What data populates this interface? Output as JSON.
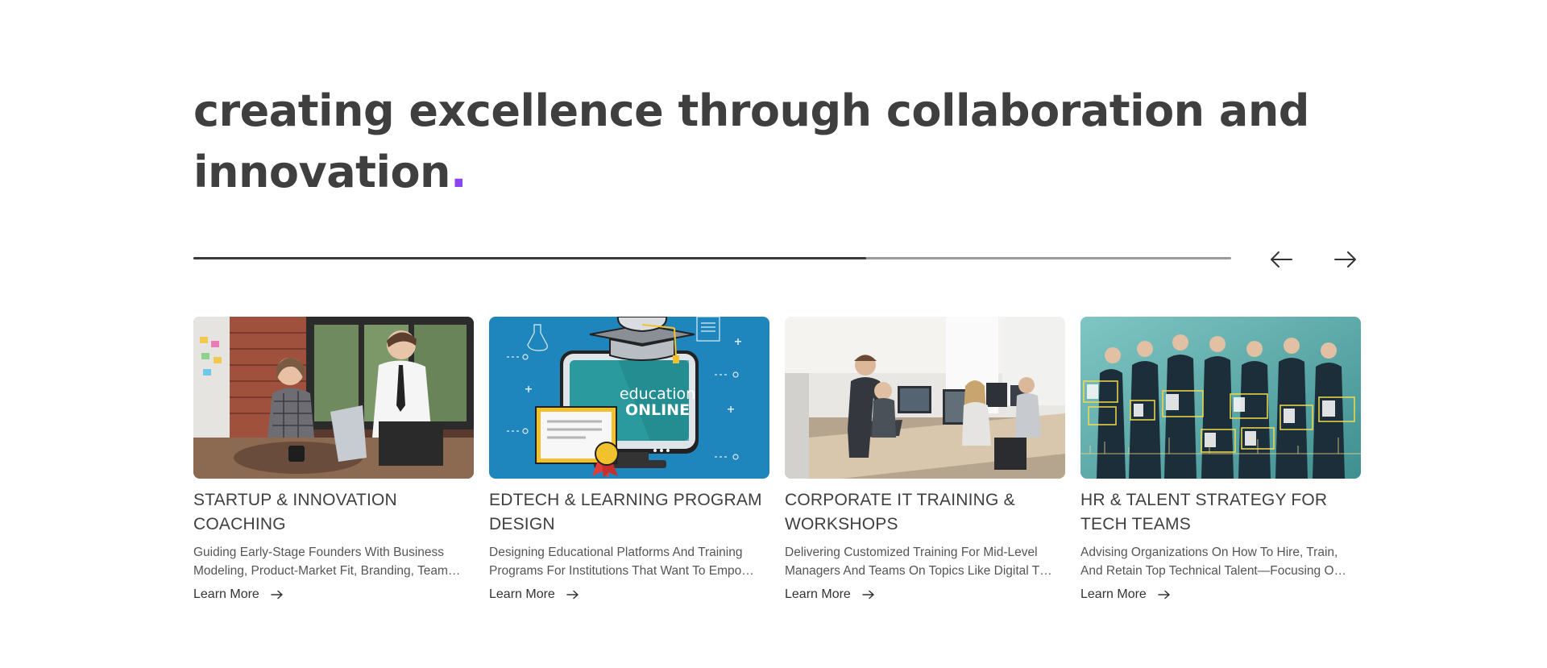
{
  "headline": {
    "line1": "creating excellence through collaboration and",
    "line2": "innovation",
    "accent_dot": ".",
    "accent_color": "#8b45f0"
  },
  "slider": {
    "progress": 0.648,
    "prev_icon": "arrow-left-icon",
    "next_icon": "arrow-right-icon"
  },
  "cards": [
    {
      "title": "STARTUP & INNOVATION COACHING",
      "desc_line1": "Guiding Early-Stage Founders With Business",
      "desc_line2": "Modeling, Product-Market Fit, Branding, Team…",
      "link": "Learn More",
      "image": "team-meeting-photo"
    },
    {
      "title": "EDTECH & LEARNING PROGRAM DESIGN",
      "desc_line1": "Designing Educational Platforms And Training",
      "desc_line2": "Programs For Institutions That Want To Empo…",
      "link": "Learn More",
      "image": "education-online-illustration",
      "image_text_1": "education",
      "image_text_2": "ONLINE"
    },
    {
      "title": "CORPORATE IT TRAINING & WORKSHOPS",
      "desc_line1": "Delivering Customized Training For Mid-Level",
      "desc_line2": "Managers And Teams On Topics Like Digital T…",
      "link": "Learn More",
      "image": "office-workstations-photo"
    },
    {
      "title": "HR & TALENT STRATEGY FOR TECH TEAMS",
      "desc_line1": "Advising Organizations On How To Hire, Train,",
      "desc_line2": "And Retain Top Technical Talent—Focusing O…",
      "link": "Learn More",
      "image": "business-team-photo"
    }
  ]
}
